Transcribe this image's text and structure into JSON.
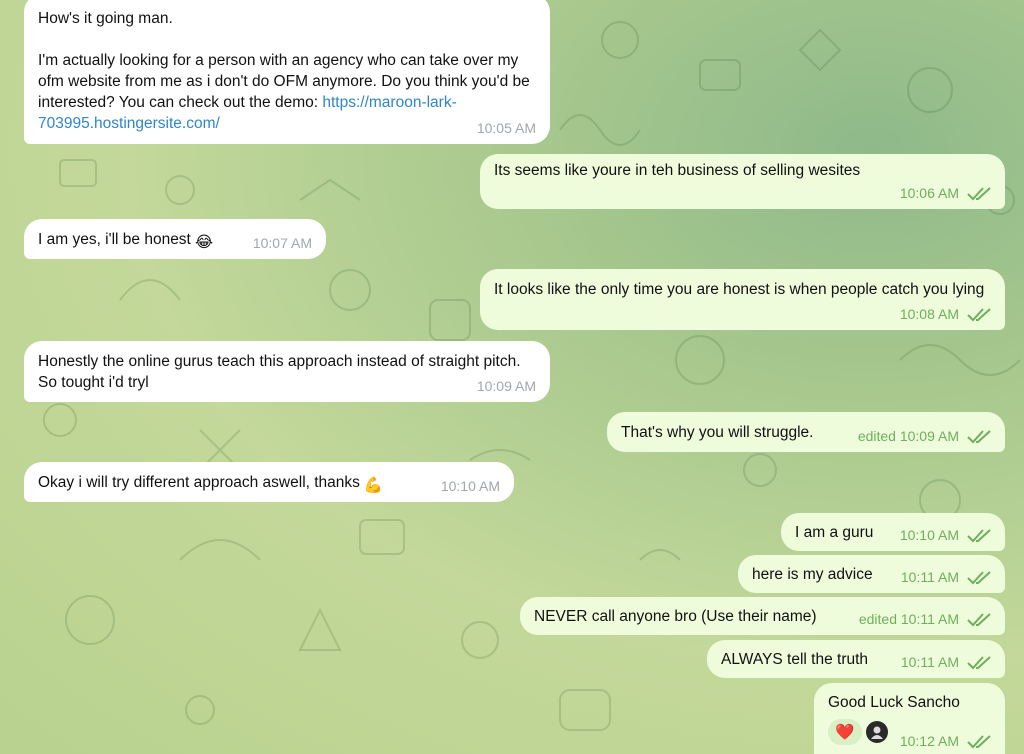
{
  "messages": [
    {
      "id": "m1",
      "dir": "in",
      "text": "How's it going man.\n\nI'm actually looking for a person with an agency who can take over my ofm website from me as i don't do OFM anymore. Do you think you'd be interested? You can check out the demo: ",
      "link": "https://maroon-lark-703995.hostingersite.com/",
      "time": "10:05 AM"
    },
    {
      "id": "m2",
      "dir": "out",
      "text": "Its seems like youre in teh business of selling wesites",
      "time": "10:06 AM"
    },
    {
      "id": "m3",
      "dir": "in",
      "text": "I am yes, i'll be honest",
      "emoji": "😂",
      "time": "10:07 AM"
    },
    {
      "id": "m4",
      "dir": "out",
      "text": "It looks like the only time you are honest is when people catch you lying",
      "time": "10:08 AM"
    },
    {
      "id": "m5",
      "dir": "in",
      "text": "Honestly the online gurus teach this approach instead of straight pitch. So tought i'd tryl",
      "time": "10:09 AM"
    },
    {
      "id": "m6",
      "dir": "out",
      "text": "That's why you will struggle.",
      "time": "edited 10:09 AM"
    },
    {
      "id": "m7",
      "dir": "in",
      "text": "Okay i will try different approach aswell, thanks",
      "emoji": "💪",
      "time": "10:10 AM"
    },
    {
      "id": "m8",
      "dir": "out",
      "text": "I am a guru",
      "time": "10:10 AM"
    },
    {
      "id": "m9",
      "dir": "out",
      "text": "here is my advice",
      "time": "10:11 AM"
    },
    {
      "id": "m10",
      "dir": "out",
      "text": "NEVER call anyone bro (Use their name)",
      "time": "edited 10:11 AM"
    },
    {
      "id": "m11",
      "dir": "out",
      "text": "ALWAYS tell the truth",
      "time": "10:11 AM"
    },
    {
      "id": "m12",
      "dir": "out",
      "text": "Good Luck Sancho",
      "time": "10:12 AM",
      "reaction": "❤️"
    }
  ],
  "colors": {
    "incoming": "#ffffff",
    "outgoing": "#eefcdc",
    "link": "#2f86c9",
    "check": "#6fae5b"
  }
}
